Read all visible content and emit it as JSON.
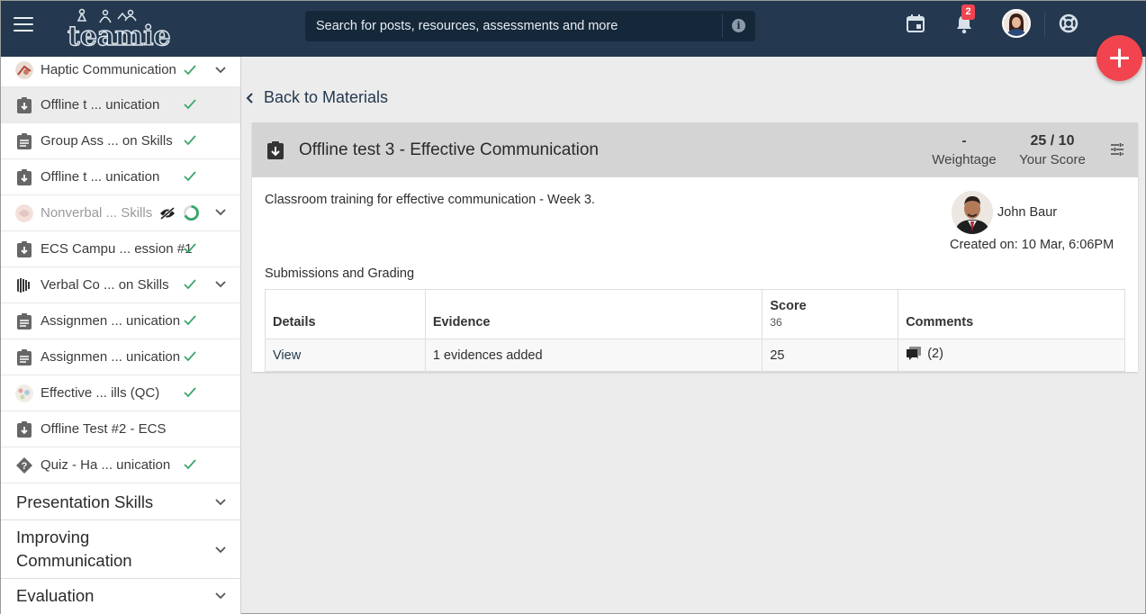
{
  "topbar": {
    "logo_text": "teamie",
    "search_placeholder": "Search for posts, resources, assessments and more",
    "notification_count": "2",
    "brand_color": "#24394f",
    "accent_color": "#f2444f"
  },
  "sidebar": {
    "items": [
      {
        "label": "Haptic Communication",
        "icon": "image-thumb-icon",
        "status": "done",
        "expandable": true
      },
      {
        "label": "Offline t ... unication",
        "icon": "offline-test-icon",
        "status": "done",
        "active": true
      },
      {
        "label": "Group Ass ... on Skills",
        "icon": "assignment-icon",
        "status": "done"
      },
      {
        "label": "Offline t ... unication",
        "icon": "offline-test-icon",
        "status": "done"
      },
      {
        "label": "Nonverbal ... Skills",
        "icon": "image-thumb-icon",
        "status": "in-progress",
        "hidden": true,
        "expandable": true
      },
      {
        "label": "ECS Campu ... ession #1",
        "icon": "offline-test-icon",
        "status": "done"
      },
      {
        "label": "Verbal Co ... on Skills",
        "icon": "sound-wave-icon",
        "status": "done",
        "expandable": true
      },
      {
        "label": "Assignmen ... unication",
        "icon": "assignment-icon",
        "status": "done"
      },
      {
        "label": "Assignmen ... unication",
        "icon": "assignment-icon",
        "status": "done"
      },
      {
        "label": "Effective ... ills (QC)",
        "icon": "image-thumb-icon",
        "status": "done"
      },
      {
        "label": "Offline Test #2 - ECS",
        "icon": "offline-test-icon",
        "status": "none"
      },
      {
        "label": "Quiz - Ha ... unication",
        "icon": "quiz-icon",
        "status": "done"
      }
    ],
    "sections": [
      {
        "label": "Presentation Skills"
      },
      {
        "label": "Improving Communication"
      },
      {
        "label": "Evaluation"
      }
    ]
  },
  "main": {
    "back_label": "Back to Materials",
    "title": "Offline test 3 - Effective Communication",
    "weightage_value": "-",
    "weightage_label": "Weightage",
    "score_value": "25 / 10",
    "score_label": "Your Score",
    "description": "Classroom training for effective communication - Week 3.",
    "author_name": "John Baur",
    "created_on": "Created on: 10 Mar, 6:06PM",
    "submissions_title": "Submissions and Grading",
    "table": {
      "headers": {
        "details": "Details",
        "evidence": "Evidence",
        "score": "Score",
        "score_max": "36",
        "comments": "Comments"
      },
      "rows": [
        {
          "details": "View",
          "evidence": "1 evidences added",
          "score": "25",
          "comments": "(2)"
        }
      ]
    }
  }
}
